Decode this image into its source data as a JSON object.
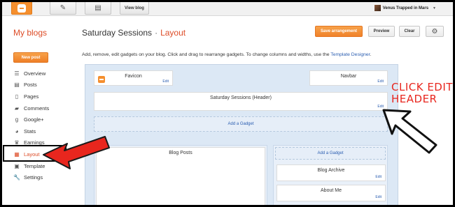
{
  "topbar": {
    "view_blog": "View blog",
    "user_name": "Venus Trapped in Mars"
  },
  "header": {
    "my_blogs": "My blogs",
    "blog_title": "Saturday Sessions",
    "separator": "·",
    "section": "Layout",
    "save_arrangement": "Save arrangement",
    "preview": "Preview",
    "clear": "Clear"
  },
  "sidebar": {
    "new_post": "New post",
    "items": [
      {
        "label": "Overview",
        "icon": "overview-icon"
      },
      {
        "label": "Posts",
        "icon": "posts-icon"
      },
      {
        "label": "Pages",
        "icon": "pages-icon"
      },
      {
        "label": "Comments",
        "icon": "comments-icon"
      },
      {
        "label": "Google+",
        "icon": "google-plus-icon"
      },
      {
        "label": "Stats",
        "icon": "stats-icon"
      },
      {
        "label": "Earnings",
        "icon": "earnings-icon"
      },
      {
        "label": "Layout",
        "icon": "layout-icon",
        "active": true
      },
      {
        "label": "Template",
        "icon": "template-icon"
      },
      {
        "label": "Settings",
        "icon": "settings-icon"
      }
    ]
  },
  "main": {
    "description": "Add, remove, edit gadgets on your blog. Click and drag to rearrange gadgets. To change columns and widths, use the ",
    "template_designer": "Template Designer",
    "period": ".",
    "favicon": {
      "title": "Favicon",
      "edit": "Edit"
    },
    "navbar": {
      "title": "Navbar",
      "edit": "Edit"
    },
    "header_gadget": {
      "title": "Saturday Sessions (Header)",
      "edit": "Edit"
    },
    "add_gadget": "Add a Gadget",
    "blog_posts": {
      "title": "Blog Posts"
    },
    "sidebar_add_gadget": "Add a Gadget",
    "blog_archive": {
      "title": "Blog Archive",
      "edit": "Edit"
    },
    "about_me": {
      "title": "About Me",
      "edit": "Edit"
    }
  },
  "annotation": {
    "line1": "CLICK EDIT",
    "line2": "HEADER"
  },
  "colors": {
    "accent_orange": "#f58f2e",
    "link_blue": "#2a5db0",
    "annotation_red": "#e8261e",
    "title_orange": "#dd4b26"
  }
}
